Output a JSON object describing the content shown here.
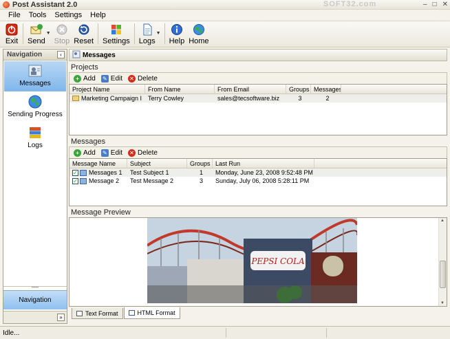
{
  "window": {
    "title": "Post Assistant 2.0",
    "watermark": "SOFT32.com"
  },
  "menu": [
    "File",
    "Tools",
    "Settings",
    "Help"
  ],
  "toolbar": {
    "exit": "Exit",
    "send": "Send",
    "stop": "Stop",
    "reset": "Reset",
    "settings": "Settings",
    "logs": "Logs",
    "help": "Help",
    "home": "Home"
  },
  "navigation": {
    "title": "Navigation",
    "items": [
      {
        "label": "Messages",
        "selected": true
      },
      {
        "label": "Sending Progress",
        "selected": false
      },
      {
        "label": "Logs",
        "selected": false
      }
    ],
    "bottom_button": "Navigation"
  },
  "main": {
    "title": "Messages"
  },
  "projects": {
    "title": "Projects",
    "actions": {
      "add": "Add",
      "edit": "Edit",
      "delete": "Delete"
    },
    "columns": [
      "Project Name",
      "From Name",
      "From Email",
      "Groups",
      "Messages"
    ],
    "rows": [
      {
        "project": "Marketing Campaign I",
        "from_name": "Terry Cowley",
        "from_email": "sales@tecsoftware.biz",
        "groups": "3",
        "messages": "2"
      }
    ]
  },
  "messages": {
    "title": "Messages",
    "actions": {
      "add": "Add",
      "edit": "Edit",
      "delete": "Delete"
    },
    "columns": [
      "Message Name",
      "Subject",
      "Groups",
      "Last Run"
    ],
    "rows": [
      {
        "name": "Messages 1",
        "subject": "Test Subject 1",
        "groups": "1",
        "last_run": "Monday, June 23, 2008  9:52:48 PM",
        "checked": true
      },
      {
        "name": "Message 2",
        "subject": "Test Message 2",
        "groups": "3",
        "last_run": "Sunday, July 06, 2008  5:28:11 PM",
        "checked": true
      }
    ]
  },
  "preview": {
    "title": "Message Preview",
    "tabs": [
      {
        "label": "Text Format",
        "active": false
      },
      {
        "label": "HTML Format",
        "active": true
      }
    ],
    "image_sign_text": "PEPSI COLA"
  },
  "status": {
    "text": "Idle..."
  }
}
